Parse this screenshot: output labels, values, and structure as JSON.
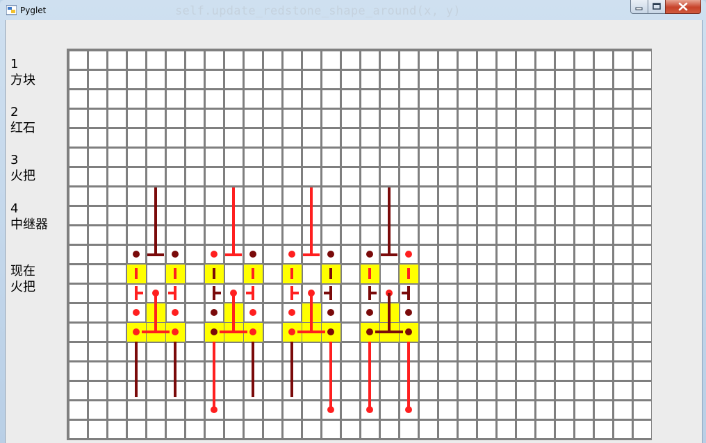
{
  "window": {
    "title": "Pyglet",
    "background_code": "self.update_redstone_shape_around(x, y)"
  },
  "controls": {
    "minimize": "minimize-icon",
    "maximize": "maximize-icon",
    "close": "close-icon"
  },
  "menu": [
    {
      "key": "1",
      "label": "方块"
    },
    {
      "key": "2",
      "label": "红石"
    },
    {
      "key": "3",
      "label": "火把"
    },
    {
      "key": "4",
      "label": "中继器"
    }
  ],
  "current": {
    "label": "现在",
    "value": "火把"
  },
  "colors": {
    "grid_line": "#7f7f7f",
    "cell": "#ffffff",
    "block": "#ffff00",
    "redstone_on": "#ff1f1f",
    "redstone_off": "#7a0a0a"
  },
  "grid": {
    "cols": 30,
    "rows": 20,
    "groups": [
      {
        "col": 3,
        "top": "off",
        "left_top": "off",
        "mid_left": "on",
        "mid_right": "on",
        "mid_torch": "on",
        "left_bottom": "on",
        "right_bottom": "on",
        "center_line": "on",
        "left_center": "on",
        "right_center": "on",
        "bottom_left": "off",
        "bottom_right": "off",
        "left_end": false,
        "right_end": false
      },
      {
        "col": 7,
        "top": "on",
        "left_top": "on",
        "mid_left": "off",
        "mid_right": "on",
        "mid_torch": "on",
        "left_bottom": "off",
        "right_bottom": "on",
        "center_line": "on",
        "left_center": "off",
        "right_center": "on",
        "bottom_left": "on",
        "bottom_right": "off",
        "left_end": true,
        "right_end": false
      },
      {
        "col": 11,
        "top": "on",
        "left_top": "on",
        "mid_left": "on",
        "mid_right": "off",
        "mid_torch": "on",
        "left_bottom": "on",
        "right_bottom": "off",
        "center_line": "on",
        "left_center": "on",
        "right_center": "off",
        "bottom_left": "off",
        "bottom_right": "on",
        "left_end": false,
        "right_end": true
      },
      {
        "col": 15,
        "top": "off",
        "left_top": "off",
        "mid_left": "on",
        "mid_right": "on",
        "mid_torch": "on",
        "left_bottom": "off",
        "right_bottom": "off",
        "center_line": "off",
        "left_center": "off",
        "right_center": "off",
        "bottom_left": "on",
        "bottom_right": "on",
        "left_end": true,
        "right_end": true
      }
    ]
  }
}
